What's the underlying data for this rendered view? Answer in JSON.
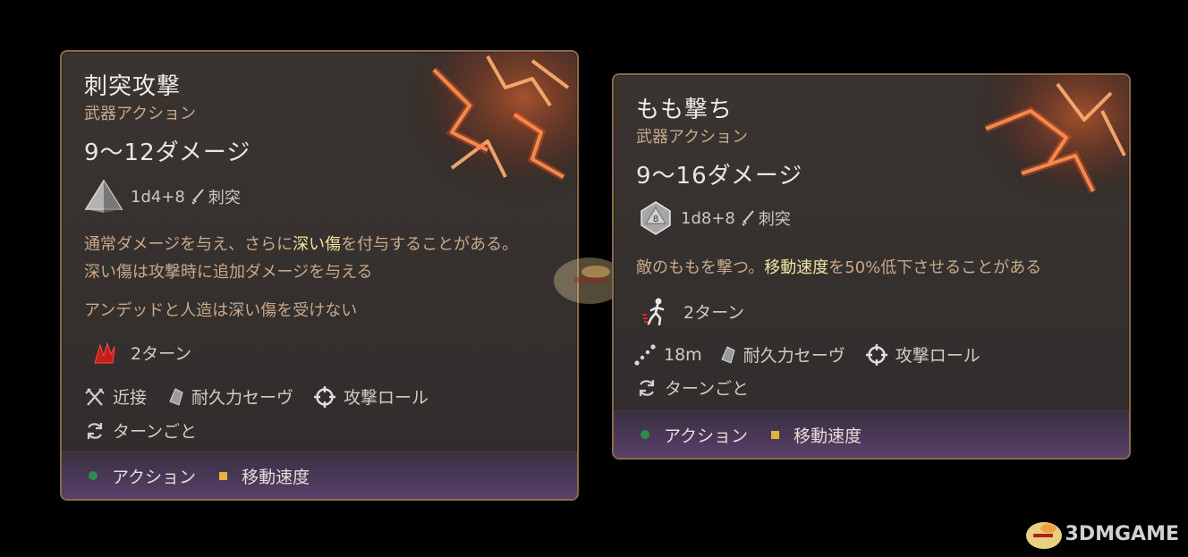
{
  "cards": [
    {
      "title": "刺突攻撃",
      "subtitle": "武器アクション",
      "damage": "9〜12ダメージ",
      "dice": "1d4+8",
      "damage_type": "刺突",
      "desc_pre": "通常ダメージを与え、さらに",
      "desc_hl": "深い傷",
      "desc_post": "を付与することがある。",
      "desc_line2": "深い傷は攻撃時に追加ダメージを与える",
      "desc_line3": "アンデッドと人造は深い傷を受けない",
      "duration": "2ターン",
      "range": "近接",
      "save": "耐久力セーヴ",
      "roll": "攻撃ロール",
      "cooldown": "ターンごと",
      "tag_action": "アクション",
      "tag_move": "移動速度"
    },
    {
      "title": "もも撃ち",
      "subtitle": "武器アクション",
      "damage": "9〜16ダメージ",
      "dice_number": "8",
      "dice": "1d8+8",
      "damage_type": "刺突",
      "desc_pre": "敵のももを撃つ。",
      "desc_hl": "移動速度",
      "desc_post": "を50%低下させることがある",
      "duration": "2ターン",
      "range": "18m",
      "save": "耐久力セーヴ",
      "roll": "攻撃ロール",
      "cooldown": "ターンごと",
      "tag_action": "アクション",
      "tag_move": "移動速度"
    }
  ],
  "watermark": {
    "text": "3DMGAME"
  },
  "colors": {
    "border": "#8a6a4c",
    "highlight": "#f3e3a0",
    "subtitle": "#c7a98a",
    "action_dot": "#2e8b4e",
    "move_square": "#e6b33a",
    "bleed_icon": "#d42a2a"
  }
}
